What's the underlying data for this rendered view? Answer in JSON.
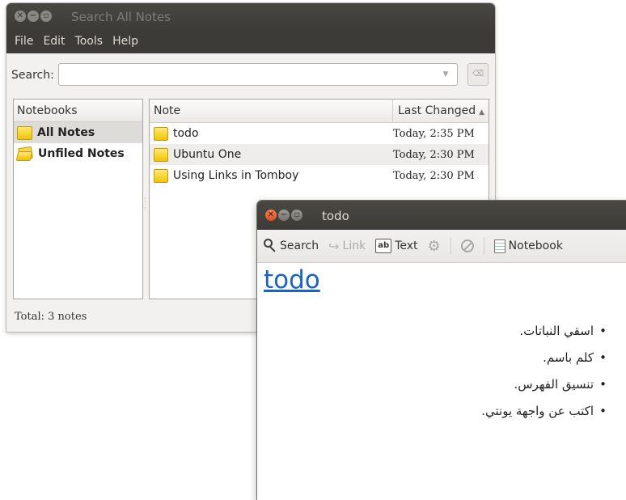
{
  "search_window": {
    "title": "Search All Notes",
    "menu": [
      "File",
      "Edit",
      "Tools",
      "Help"
    ],
    "search_label": "Search:",
    "search_value": "",
    "notebooks_header": "Notebooks",
    "notebooks": [
      {
        "label": "All Notes",
        "icon": "note-folder-icon"
      },
      {
        "label": "Unfiled Notes",
        "icon": "open-folder-icon"
      }
    ],
    "columns": {
      "note": "Note",
      "changed": "Last Changed"
    },
    "notes": [
      {
        "title": "todo",
        "changed": "Today, 2:35 PM"
      },
      {
        "title": "Ubuntu One",
        "changed": "Today, 2:30 PM"
      },
      {
        "title": "Using Links in Tomboy",
        "changed": "Today, 2:30 PM"
      }
    ],
    "status": "Total: 3 notes"
  },
  "note_window": {
    "title": "todo",
    "toolbar": {
      "search": "Search",
      "link": "Link",
      "text": "Text",
      "notebook": "Notebook"
    },
    "note_title": "todo",
    "items": [
      "اسقي النباتات.",
      "كلم باسم.",
      "تنسيق الفهرس.",
      "اكتب عن واجهة يونتي."
    ]
  },
  "colors": {
    "titlebar": "#3c3b37",
    "close_button": "#df4a16",
    "link_blue": "#1b63c8",
    "note_icon": "#f1c500"
  }
}
